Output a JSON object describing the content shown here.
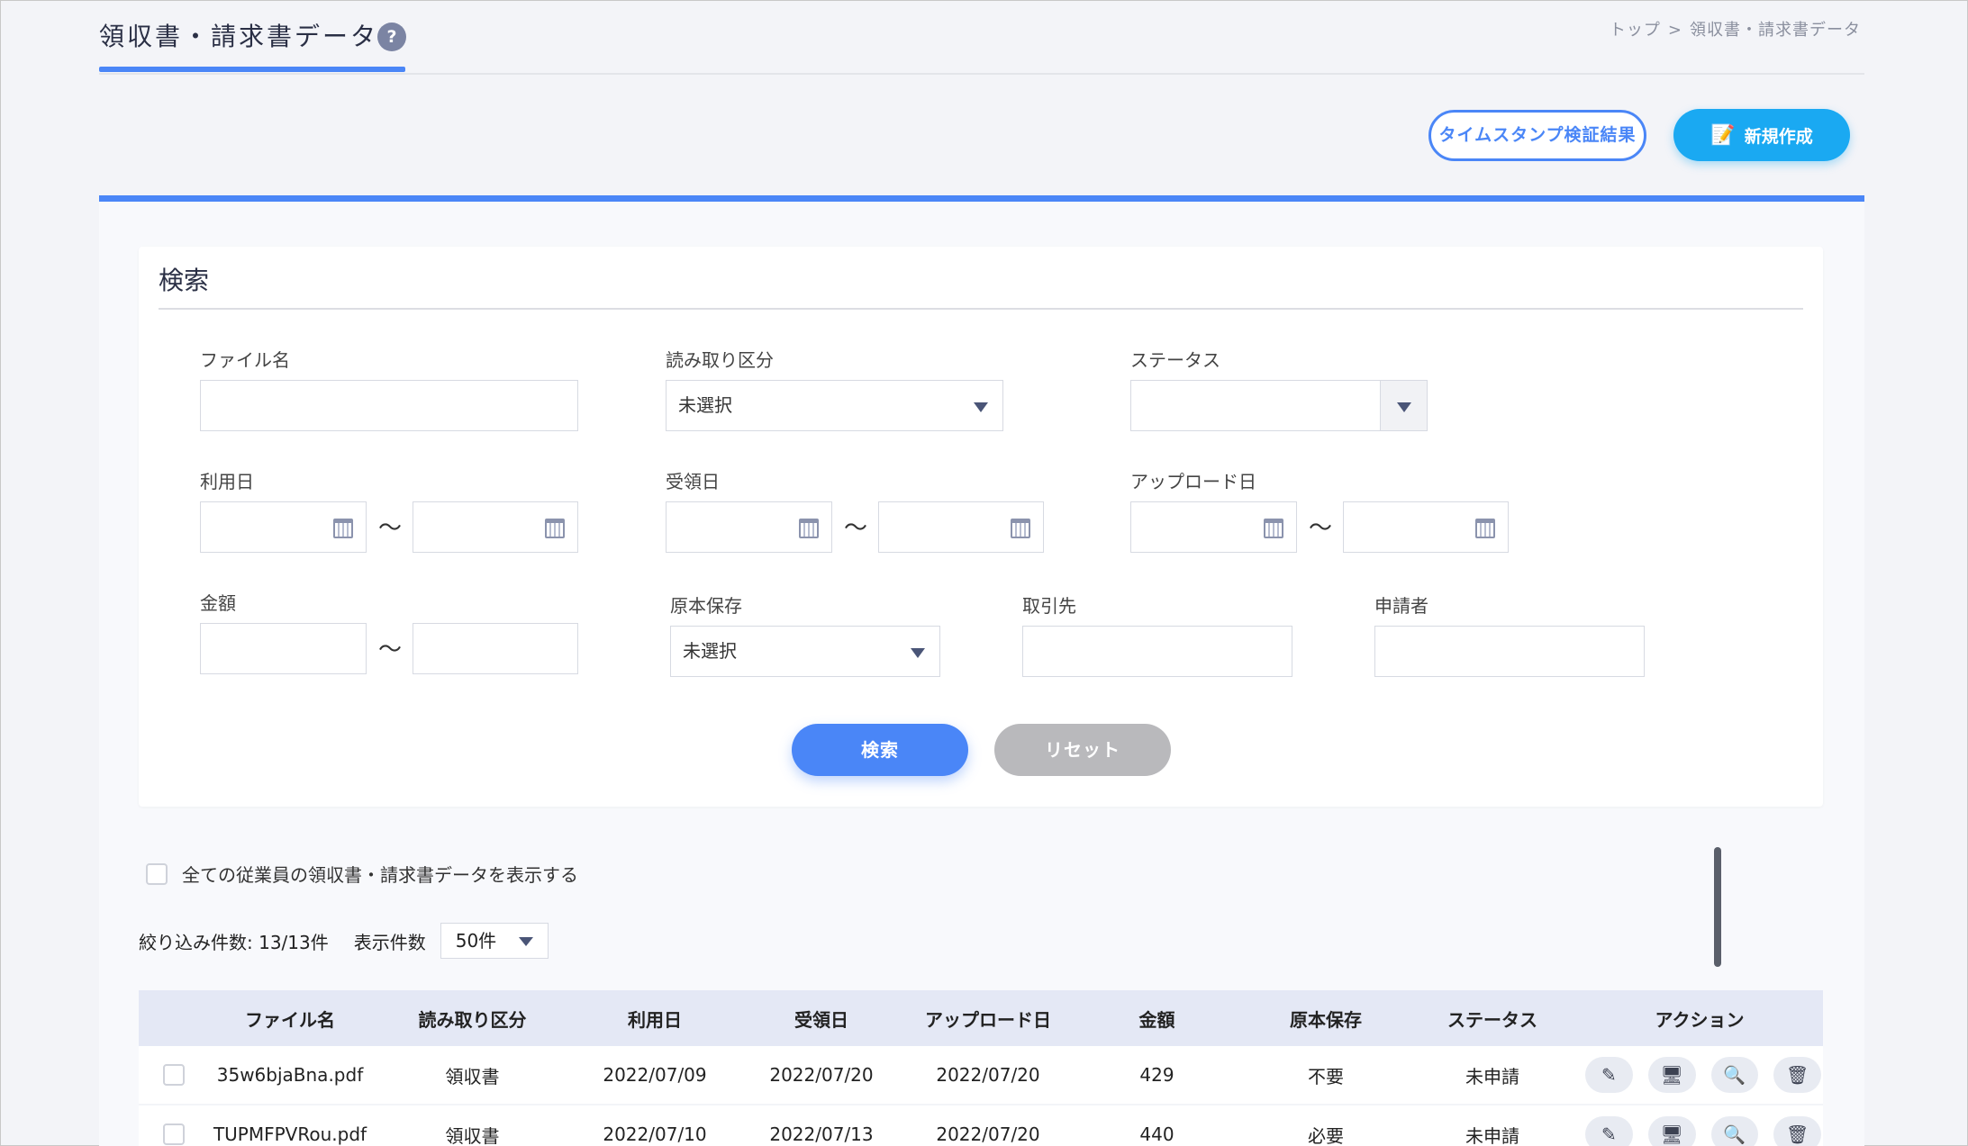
{
  "header": {
    "title": "領収書・請求書データ",
    "help_icon": "?",
    "breadcrumb": [
      "トップ",
      ">",
      "領収書・請求書データ"
    ]
  },
  "actions": {
    "timestamp_button": "タイムスタンプ検証結果",
    "new_button": "新規作成",
    "new_button_icon": "edit-document-icon"
  },
  "search": {
    "heading": "検索",
    "file_name_label": "ファイル名",
    "read_type_label": "読み取り区分",
    "read_type_value": "未選択",
    "status_label": "ステータス",
    "status_value": "",
    "use_date_label": "利用日",
    "receive_date_label": "受領日",
    "upload_date_label": "アップロード日",
    "amount_label": "金額",
    "original_label": "原本保存",
    "original_value": "未選択",
    "partner_label": "取引先",
    "applicant_label": "申請者",
    "range_separator": "〜",
    "search_button": "検索",
    "reset_button": "リセット"
  },
  "list": {
    "show_all_label": "全ての従業員の領収書・請求書データを表示する",
    "count_label": "絞り込み件数: 13/13件",
    "per_page_label": "表示件数",
    "per_page_value": "50件",
    "columns": [
      "ファイル名",
      "読み取り区分",
      "利用日",
      "受領日",
      "アップロード日",
      "金額",
      "原本保存",
      "ステータス",
      "アクション"
    ],
    "rows": [
      {
        "file": "35w6bjaBna.pdf",
        "type": "領収書",
        "use_date": "2022/07/09",
        "receive_date": "2022/07/20",
        "upload_date": "2022/07/20",
        "amount": "429",
        "original": "不要",
        "status": "未申請"
      },
      {
        "file": "TUPMFPVRou.pdf",
        "type": "領収書",
        "use_date": "2022/07/10",
        "receive_date": "2022/07/13",
        "upload_date": "2022/07/20",
        "amount": "440",
        "original": "必要",
        "status": "未申請"
      }
    ],
    "action_icons": {
      "edit": "✎",
      "display": "🖥",
      "preview": "🔍",
      "delete": "🗑"
    }
  }
}
